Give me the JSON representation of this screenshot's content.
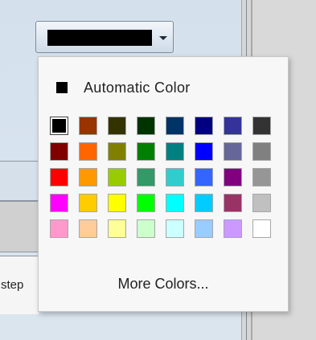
{
  "dialog": {
    "step_text": "step"
  },
  "color_button": {
    "selected_color": "#000000",
    "arrow_icon": "chevron-down-icon"
  },
  "popup": {
    "automatic_label": "Automatic Color",
    "automatic_color": "#000000",
    "more_colors_label": "More Colors...",
    "selected_index": 0,
    "palette": [
      "#000000",
      "#993300",
      "#333300",
      "#003300",
      "#003366",
      "#000080",
      "#333399",
      "#333333",
      "#800000",
      "#FF6600",
      "#808000",
      "#008000",
      "#008080",
      "#0000FF",
      "#666699",
      "#808080",
      "#FF0000",
      "#FF9900",
      "#99CC00",
      "#339966",
      "#33CCCC",
      "#3366FF",
      "#800080",
      "#969696",
      "#FF00FF",
      "#FFCC00",
      "#FFFF00",
      "#00FF00",
      "#00FFFF",
      "#00CCFF",
      "#993366",
      "#C0C0C0",
      "#FF99CC",
      "#FFCC99",
      "#FFFF99",
      "#CCFFCC",
      "#CCFFFF",
      "#99CCFF",
      "#CC99FF",
      "#FFFFFF"
    ]
  }
}
